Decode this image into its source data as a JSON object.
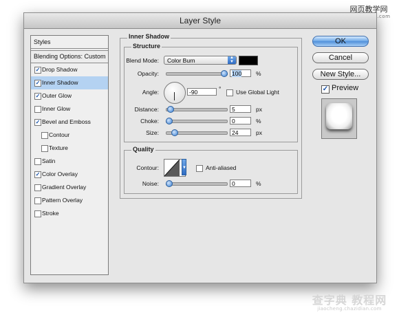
{
  "window": {
    "title": "Layer Style"
  },
  "styles_panel": {
    "header": "Styles",
    "blending_options": "Blending Options: Custom",
    "items": [
      {
        "label": "Drop Shadow",
        "checked": true,
        "selected": false,
        "indent": false
      },
      {
        "label": "Inner Shadow",
        "checked": true,
        "selected": true,
        "indent": false
      },
      {
        "label": "Outer Glow",
        "checked": true,
        "selected": false,
        "indent": false
      },
      {
        "label": "Inner Glow",
        "checked": false,
        "selected": false,
        "indent": false
      },
      {
        "label": "Bevel and Emboss",
        "checked": true,
        "selected": false,
        "indent": false
      },
      {
        "label": "Contour",
        "checked": false,
        "selected": false,
        "indent": true
      },
      {
        "label": "Texture",
        "checked": false,
        "selected": false,
        "indent": true
      },
      {
        "label": "Satin",
        "checked": false,
        "selected": false,
        "indent": false
      },
      {
        "label": "Color Overlay",
        "checked": true,
        "selected": false,
        "indent": false
      },
      {
        "label": "Gradient Overlay",
        "checked": false,
        "selected": false,
        "indent": false
      },
      {
        "label": "Pattern Overlay",
        "checked": false,
        "selected": false,
        "indent": false
      },
      {
        "label": "Stroke",
        "checked": false,
        "selected": false,
        "indent": false
      }
    ]
  },
  "inner_shadow": {
    "title": "Inner Shadow",
    "structure": {
      "title": "Structure",
      "blend_mode_label": "Blend Mode:",
      "blend_mode_value": "Color Burn",
      "color": "#000000",
      "opacity_label": "Opacity:",
      "opacity_value": "100",
      "opacity_unit": "%",
      "opacity_level": 1.0,
      "angle_label": "Angle:",
      "angle_value": "-90",
      "angle_unit": "°",
      "use_global_light_label": "Use Global Light",
      "use_global_light": false,
      "distance_label": "Distance:",
      "distance_value": "5",
      "distance_unit": "px",
      "distance_level": 0.02,
      "choke_label": "Choke:",
      "choke_value": "0",
      "choke_unit": "%",
      "choke_level": 0.0,
      "size_label": "Size:",
      "size_value": "24",
      "size_unit": "px",
      "size_level": 0.1
    },
    "quality": {
      "title": "Quality",
      "contour_label": "Contour:",
      "anti_aliased_label": "Anti-aliased",
      "anti_aliased": false,
      "noise_label": "Noise:",
      "noise_value": "0",
      "noise_unit": "%",
      "noise_level": 0.0
    }
  },
  "buttons": {
    "ok": "OK",
    "cancel": "Cancel",
    "new_style": "New Style...",
    "preview_label": "Preview",
    "preview_checked": true
  },
  "watermarks": {
    "top_text": "网页教学网",
    "top_url": "www.webjx.com",
    "bottom_text": "查字典 教程网",
    "bottom_url": "jiaocheng.chazidian.com"
  },
  "icons": {
    "check": "checkmark-icon",
    "dropdown": "dropdown-arrows-icon",
    "dial": "angle-dial-icon",
    "contour": "contour-curve-icon"
  }
}
